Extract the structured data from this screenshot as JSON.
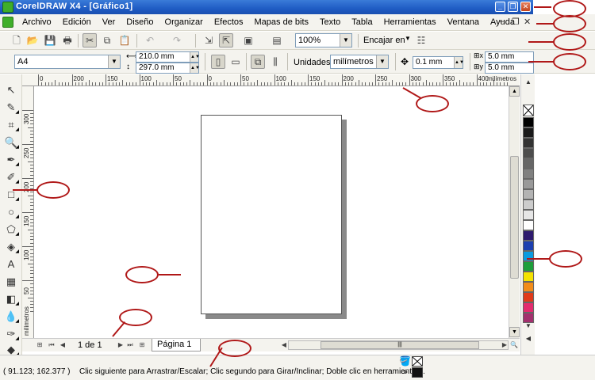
{
  "window": {
    "title": "CorelDRAW X4 - [Gráfico1]"
  },
  "menubar": {
    "items": [
      "Archivo",
      "Edición",
      "Ver",
      "Diseño",
      "Organizar",
      "Efectos",
      "Mapas de bits",
      "Texto",
      "Tabla",
      "Herramientas",
      "Ventana",
      "Ayuda"
    ]
  },
  "standard_toolbar": {
    "zoom_value": "100%",
    "snap_label": "Encajar en"
  },
  "property_bar": {
    "paper_size": "A4",
    "width": "210.0 mm",
    "height": "297.0 mm",
    "units_label": "Unidades:",
    "units_value": "milímetros",
    "nudge": "0.1 mm",
    "dup_x": "5.0 mm",
    "dup_y": "5.0 mm"
  },
  "rulers": {
    "h_labels": [
      "0",
      "200",
      "150",
      "100",
      "50",
      "0",
      "50",
      "100",
      "150",
      "200",
      "250",
      "300",
      "350",
      "400"
    ],
    "h_unit": "milímetros",
    "v_labels": [
      "300",
      "250",
      "200",
      "150",
      "100",
      "50"
    ],
    "v_unit": "milímetros"
  },
  "page_nav": {
    "counter": "1 de 1",
    "page_tab": "Página 1"
  },
  "statusbar": {
    "coords": "( 91.123; 162.377 )",
    "message": "Clic siguiente para Arrastrar/Escalar; Clic segundo para Girar/Inclinar; Doble clic en herramienta ..."
  },
  "palette": {
    "colors": [
      "#000000",
      "#1a1a1a",
      "#333333",
      "#4d4d4d",
      "#666666",
      "#808080",
      "#999999",
      "#b3b3b3",
      "#cccccc",
      "#e6e6e6",
      "#ffffff",
      "#2e1a6e",
      "#1c3fb0",
      "#0b9be0",
      "#1e9e3a",
      "#f4e200",
      "#f28c1a",
      "#e03a1a",
      "#e32b6e",
      "#a3306e"
    ]
  },
  "accent_colors": {
    "titlebar": "#1f5cc4",
    "annotation": "#b01818"
  }
}
